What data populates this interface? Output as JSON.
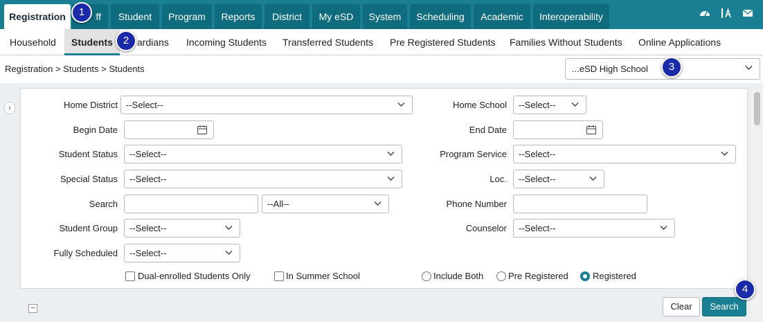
{
  "top_nav": {
    "tabs": [
      "Registration",
      "Staff",
      "Student",
      "Program",
      "Reports",
      "District",
      "My eSD",
      "System",
      "Scheduling",
      "Academic",
      "Interoperability"
    ],
    "staff_visible_label": "ff",
    "icons": [
      "dashboard-icon",
      "font-size-icon",
      "mail-icon"
    ]
  },
  "sub_nav": {
    "items": [
      "Household",
      "Students",
      "Guardians",
      "Incoming Students",
      "Transferred Students",
      "Pre Registered Students",
      "Families Without Students",
      "Online Applications"
    ],
    "guardians_visible_label": "ardians"
  },
  "breadcrumb": "Registration > Students > Students",
  "school_selector": {
    "value": "...eSD High School"
  },
  "form": {
    "home_district": {
      "label": "Home District",
      "value": "--Select--"
    },
    "home_school": {
      "label": "Home School",
      "value": "--Select--"
    },
    "begin_date": {
      "label": "Begin Date",
      "value": ""
    },
    "end_date": {
      "label": "End Date",
      "value": ""
    },
    "student_status": {
      "label": "Student Status",
      "value": "--Select--"
    },
    "program_service": {
      "label": "Program Service",
      "value": "--Select--"
    },
    "special_status": {
      "label": "Special Status",
      "value": "--Select--"
    },
    "loc": {
      "label": "Loc.",
      "value": "--Select--"
    },
    "search": {
      "label": "Search",
      "value": "",
      "scope": "--All--"
    },
    "phone_number": {
      "label": "Phone Number",
      "value": ""
    },
    "student_group": {
      "label": "Student Group",
      "value": "--Select--"
    },
    "counselor": {
      "label": "Counselor",
      "value": "--Select--"
    },
    "fully_scheduled": {
      "label": "Fully Scheduled",
      "value": "--Select--"
    },
    "checkboxes": [
      {
        "label": "Dual-enrolled Students Only",
        "checked": false
      },
      {
        "label": "In Summer School",
        "checked": false
      }
    ],
    "registration_radio": {
      "options": [
        "Include Both",
        "Pre Registered",
        "Registered"
      ],
      "selected": "Registered"
    }
  },
  "buttons": {
    "clear": "Clear",
    "search": "Search"
  },
  "callouts": [
    "1",
    "2",
    "3",
    "4"
  ],
  "colors": {
    "accent": "#1a7f93",
    "callout": "#1a2aa8"
  }
}
